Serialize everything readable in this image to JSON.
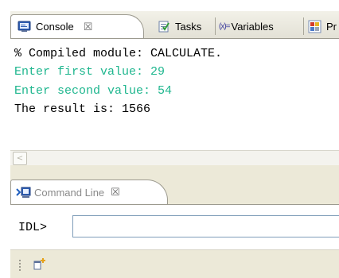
{
  "tabs": [
    {
      "label": "Console",
      "icon": "console-icon",
      "active": true
    },
    {
      "label": "Tasks",
      "icon": "tasks-icon"
    },
    {
      "label": "Variables",
      "icon": "variables-icon",
      "glyph": "(x)="
    },
    {
      "label": "Pr",
      "icon": "problems-icon"
    }
  ],
  "close_glyph": "☒",
  "console": {
    "lines": [
      "% Compiled module: CALCULATE.",
      "Enter first value: 29",
      "Enter second value: 54",
      "The result is: 1566"
    ],
    "input_color": "#1eb68e",
    "scroll_left_glyph": "<"
  },
  "command_line": {
    "tab_label": "Command Line",
    "prompt": "IDL>",
    "input_value": ""
  }
}
